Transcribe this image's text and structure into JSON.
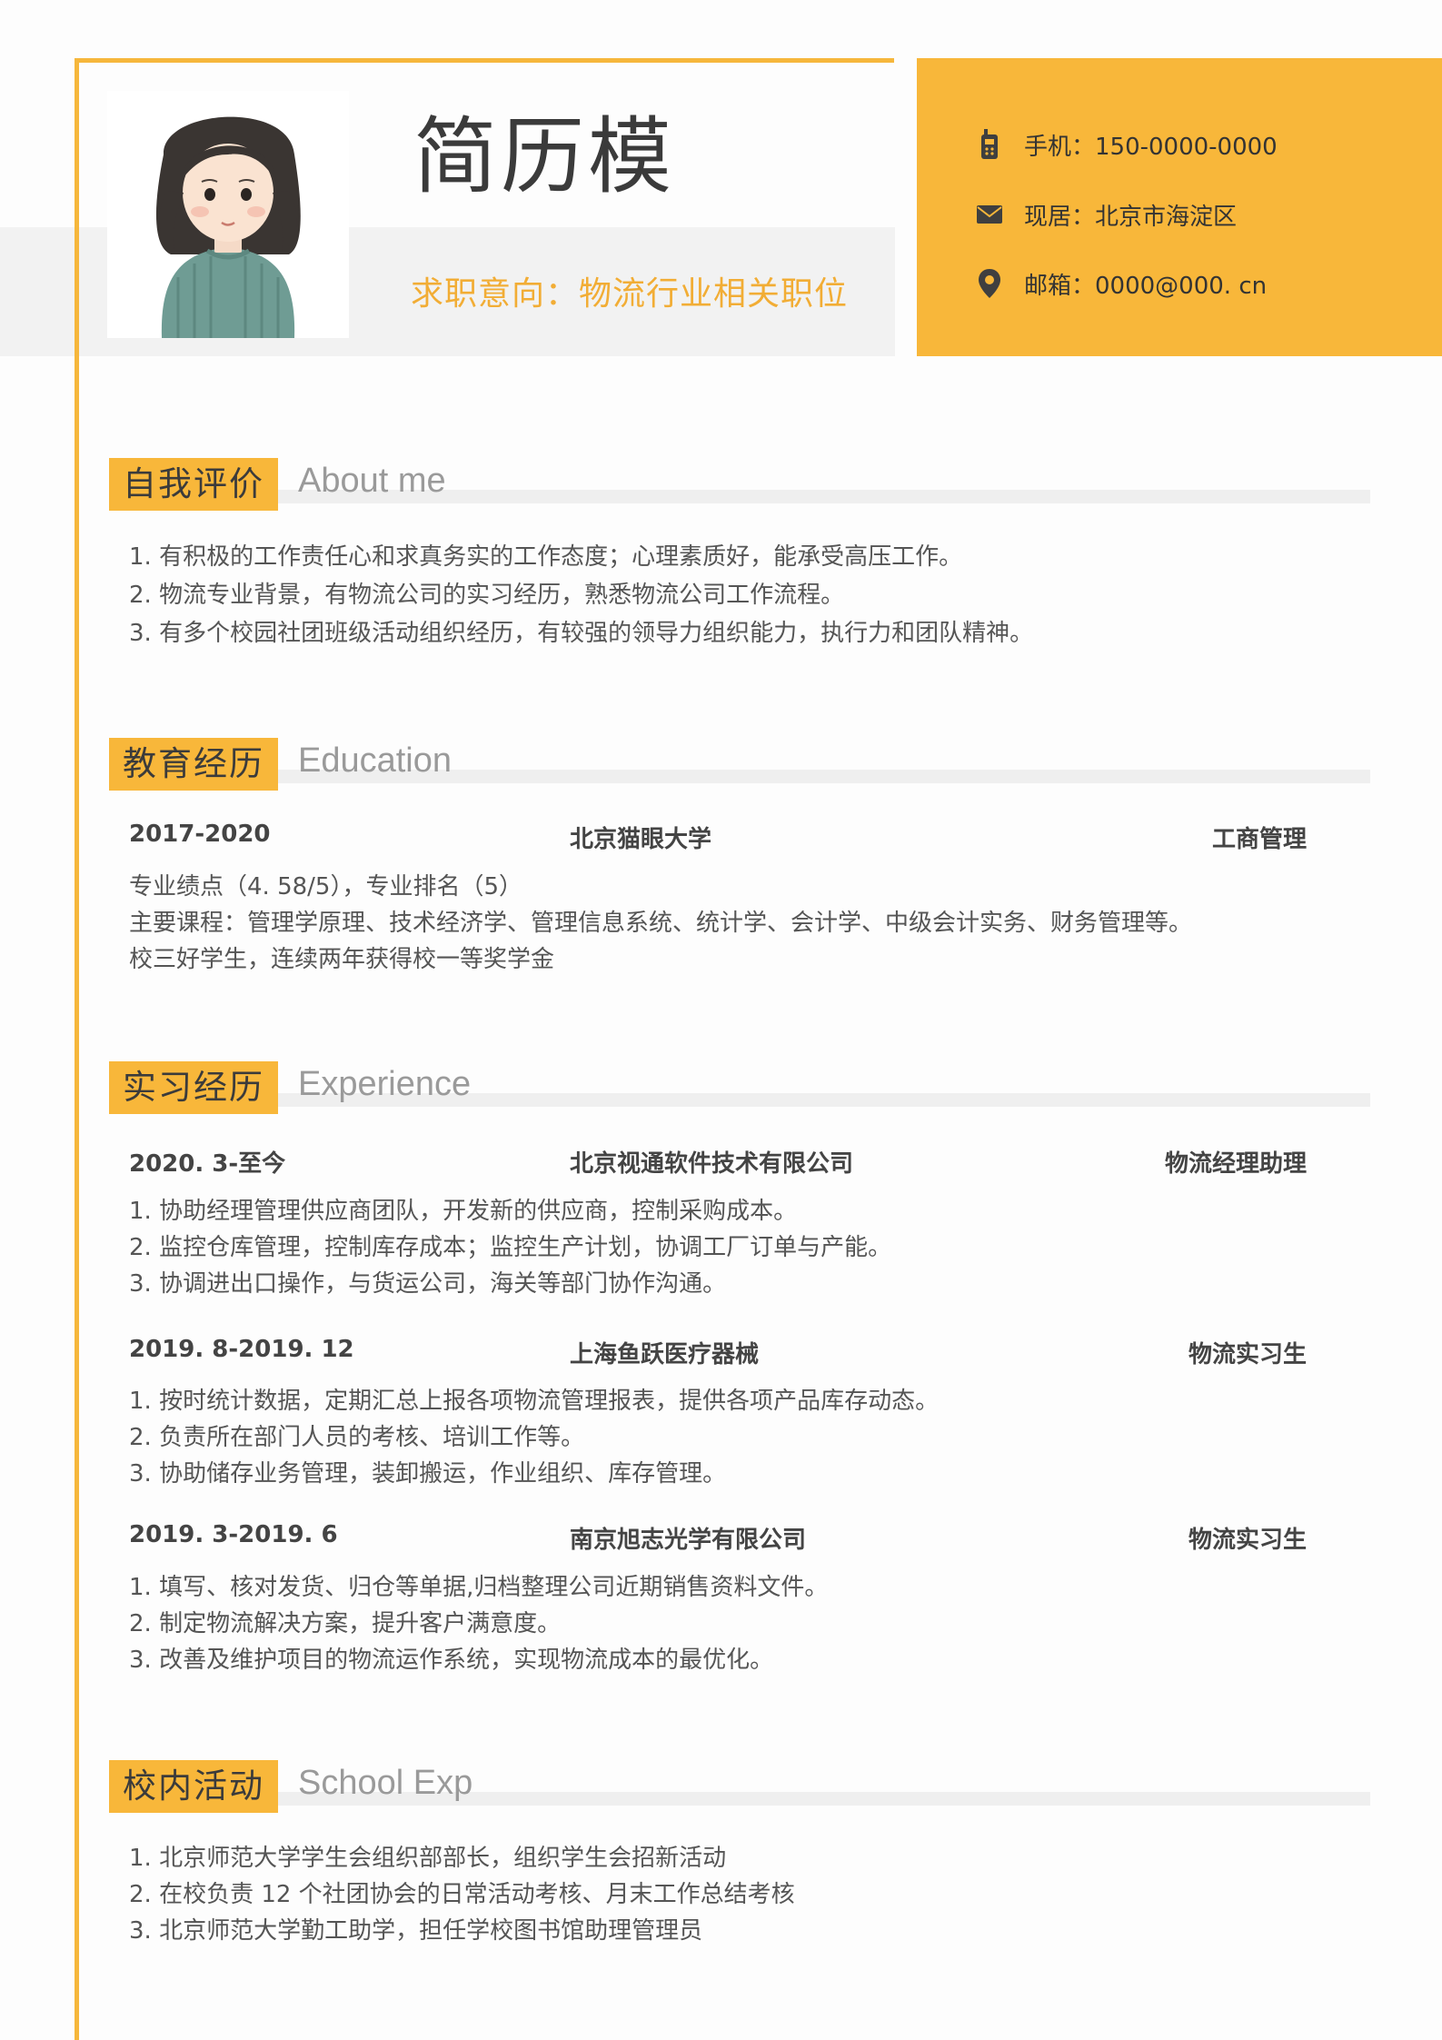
{
  "header": {
    "name": "简历模",
    "intent": "求职意向：物流行业相关职位"
  },
  "contact": {
    "phone": "手机：150-0000-0000",
    "address": "现居：北京市海淀区",
    "email": "邮箱：0000@000. cn"
  },
  "about": {
    "title_zh": "自我评价",
    "title_en": "About me",
    "lines": [
      "1. 有积极的工作责任心和求真务实的工作态度；心理素质好，能承受高压工作。",
      "2. 物流专业背景，有物流公司的实习经历，熟悉物流公司工作流程。",
      "3. 有多个校园社团班级活动组织经历，有较强的领导力组织能力，执行力和团队精神。"
    ]
  },
  "education": {
    "title_zh": "教育经历",
    "title_en": "Education",
    "period": "2017-2020",
    "school": "北京猫眼大学",
    "major": "工商管理",
    "lines": [
      "专业绩点（4. 58/5），专业排名（5）",
      "主要课程：管理学原理、技术经济学、管理信息系统、统计学、会计学、中级会计实务、财务管理等。",
      "校三好学生，连续两年获得校一等奖学金"
    ]
  },
  "experience": {
    "title_zh": "实习经历",
    "title_en": "Experience",
    "jobs": [
      {
        "period": "2020. 3-至今",
        "company": "北京视通软件技术有限公司",
        "role": "物流经理助理",
        "lines": [
          "1. 协助经理管理供应商团队，开发新的供应商，控制采购成本。",
          "2. 监控仓库管理，控制库存成本；监控生产计划，协调工厂订单与产能。",
          "3. 协调进出口操作，与货运公司，海关等部门协作沟通。"
        ]
      },
      {
        "period": "2019. 8-2019. 12",
        "company": "上海鱼跃医疗器械",
        "role": "物流实习生",
        "lines": [
          "1. 按时统计数据，定期汇总上报各项物流管理报表，提供各项产品库存动态。",
          "2. 负责所在部门人员的考核、培训工作等。",
          "3. 协助储存业务管理，装卸搬运，作业组织、库存管理。"
        ]
      },
      {
        "period": "2019. 3-2019. 6",
        "company": "南京旭志光学有限公司",
        "role": "物流实习生",
        "lines": [
          "1. 填写、核对发货、归仓等单据,归档整理公司近期销售资料文件。",
          "2. 制定物流解决方案，提升客户满意度。",
          "3. 改善及维护项目的物流运作系统，实现物流成本的最优化。"
        ]
      }
    ]
  },
  "school": {
    "title_zh": "校内活动",
    "title_en": "School Exp",
    "lines": [
      "1. 北京师范大学学生会组织部部长，组织学生会招新活动",
      "2. 在校负责 12 个社团协会的日常活动考核、月末工作总结考核",
      "3. 北京师范大学勤工助学，担任学校图书馆助理管理员"
    ]
  },
  "colors": {
    "accent": "#f8b73a",
    "frame": "#f6b73c",
    "intent_text": "#f2ad35",
    "bar_gray": "#efefef"
  }
}
